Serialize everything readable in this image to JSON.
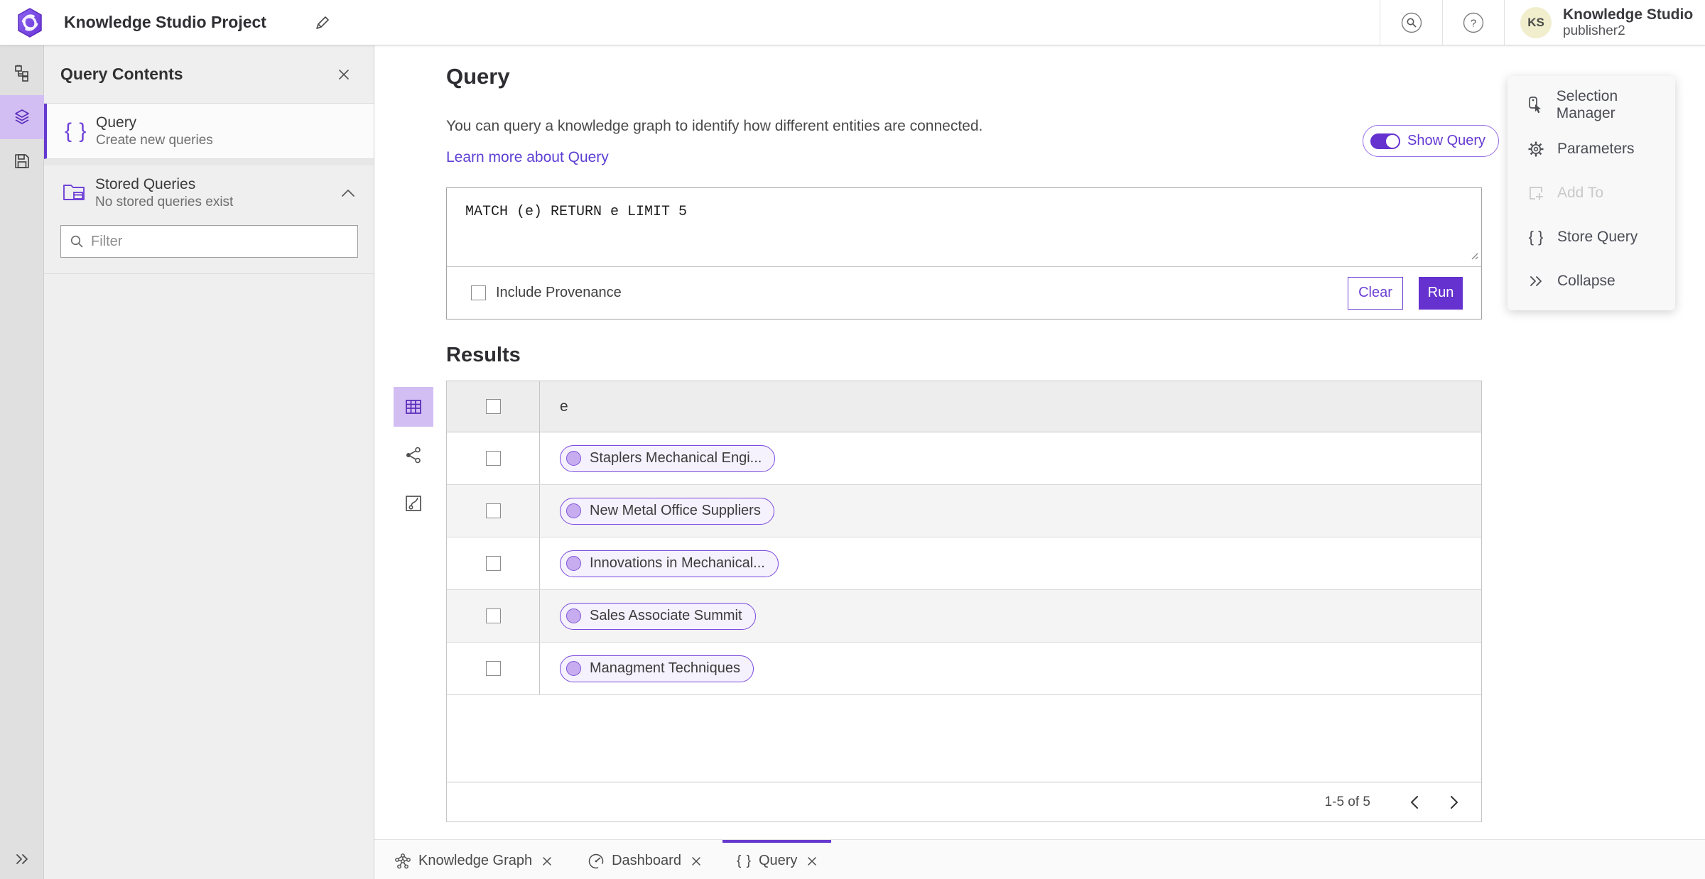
{
  "topbar": {
    "title": "Knowledge Studio Project",
    "app_name": "Knowledge Studio",
    "username": "publisher2",
    "avatar_initials": "KS"
  },
  "left_panel": {
    "title": "Query Contents",
    "query_item": {
      "label": "Query",
      "sublabel": "Create new queries",
      "icon": "{ }"
    },
    "stored_item": {
      "label": "Stored Queries",
      "sublabel": "No stored queries exist"
    },
    "filter_placeholder": "Filter"
  },
  "query_section": {
    "heading": "Query",
    "description": "You can query a knowledge graph to identify how different entities are connected.",
    "link_label": "Learn more about Query",
    "toggle_label": "Show Query",
    "query_text": "MATCH (e) RETURN e LIMIT 5",
    "provenance_label": "Include Provenance",
    "clear_label": "Clear",
    "run_label": "Run"
  },
  "results": {
    "heading": "Results",
    "column_header": "e",
    "rows": [
      "Staplers Mechanical Engi...",
      "New Metal Office Suppliers",
      "Innovations in Mechanical...",
      "Sales Associate Summit",
      "Managment Techniques"
    ],
    "pagination": "1-5 of 5"
  },
  "right_panel": {
    "items": [
      {
        "label": "Selection Manager"
      },
      {
        "label": "Parameters"
      },
      {
        "label": "Add To"
      },
      {
        "label": "Store Query",
        "icon": "{ }"
      },
      {
        "label": "Collapse"
      }
    ]
  },
  "tabs": [
    {
      "label": "Knowledge Graph"
    },
    {
      "label": "Dashboard"
    },
    {
      "label": "Query",
      "icon": "{ }"
    }
  ],
  "colors": {
    "accent": "#6531cf",
    "accent_light_bg": "#d2bef3",
    "link": "#5d3fd3",
    "pill_border": "#7a4add",
    "pill_dot": "#c7adf0",
    "avatar_bg": "#f1eecd"
  }
}
